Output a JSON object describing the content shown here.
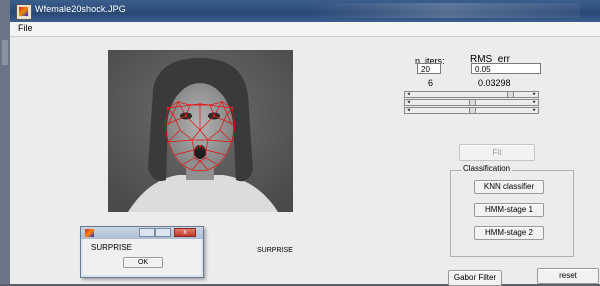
{
  "window": {
    "title": "Wfemale20shock.JPG"
  },
  "menu": {
    "file_label": "File"
  },
  "params": {
    "n_iters_label": "n_iters:",
    "n_iters_value": "20",
    "rms_err_label": "RMS_err",
    "rms_err_value": "0.05",
    "iter_count": "6",
    "rms_current": "0.03298",
    "slider_levels": [
      0.83,
      0.5,
      0.5
    ]
  },
  "buttons": {
    "fit_label": "Fit",
    "knn_label": "KNN classifier",
    "hmm1_label": "HMM-stage 1",
    "hmm2_label": "HMM-stage 2",
    "gabor_label": "Gabor Filter",
    "reset_label": "reset"
  },
  "classification": {
    "panel_title": "Classification"
  },
  "result": {
    "text": "SURPRISE"
  },
  "dialog": {
    "message": "SURPRISE",
    "ok_label": "OK",
    "close_glyph": "x"
  },
  "icons": [
    "matlab-figure-icon",
    "close-icon",
    "minimize-icon",
    "maximize-icon"
  ]
}
